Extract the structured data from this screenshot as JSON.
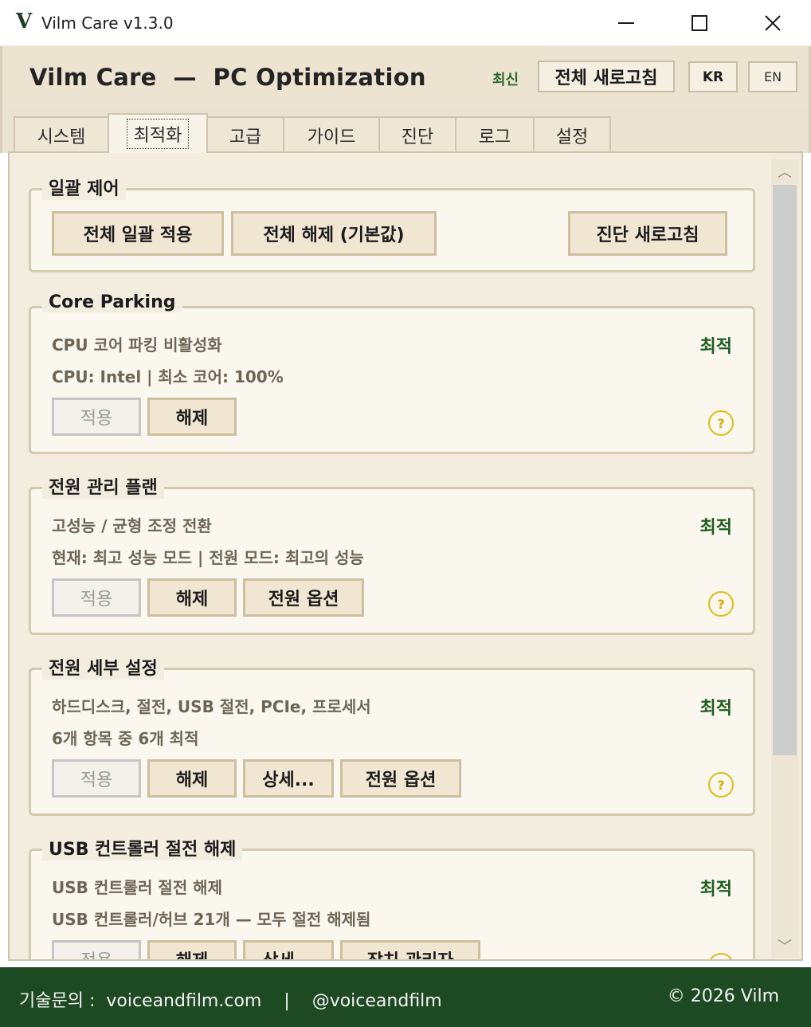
{
  "window": {
    "logo": "V",
    "title": "Vilm Care v1.3.0",
    "minimize": "—",
    "maximize": "☐",
    "close": "✕"
  },
  "header": {
    "app_title": "Vilm Care  —  PC Optimization",
    "latest_badge": "최신",
    "refresh_all": "전체 새로고침",
    "lang_kr": "KR",
    "lang_en": "EN"
  },
  "tabs": [
    {
      "label": "시스템",
      "active": false
    },
    {
      "label": "최적화",
      "active": true
    },
    {
      "label": "고급",
      "active": false
    },
    {
      "label": "가이드",
      "active": false
    },
    {
      "label": "진단",
      "active": false
    },
    {
      "label": "로그",
      "active": false
    },
    {
      "label": "설정",
      "active": false
    }
  ],
  "bulk": {
    "title": "일괄 제어",
    "apply_all": "전체 일괄 적용",
    "release_all": "전체 해제 (기본값)",
    "diag_refresh": "진단 새로고침"
  },
  "sections": [
    {
      "title": "Core Parking",
      "line1": "CPU 코어 파킹 비활성화",
      "line2": "CPU: Intel | 최소 코어: 100%",
      "status": "최적",
      "apply": "적용",
      "release": "해제",
      "help": "?"
    },
    {
      "title": "전원 관리 플랜",
      "line1": "고성능 / 균형 조정 전환",
      "line2": "현재: 최고 성능 모드 | 전원 모드: 최고의 성능",
      "status": "최적",
      "apply": "적용",
      "release": "해제",
      "extra1": "전원 옵션",
      "help": "?"
    },
    {
      "title": "전원 세부 설정",
      "line1": "하드디스크, 절전, USB 절전, PCIe, 프로세서",
      "line2": "6개 항목 중 6개 최적",
      "status": "최적",
      "apply": "적용",
      "release": "해제",
      "extra1": "상세...",
      "extra2": "전원 옵션",
      "help": "?"
    },
    {
      "title": "USB 컨트롤러 절전 해제",
      "line1": "USB 컨트롤러 절전 해제",
      "line2": "USB 컨트롤러/허브 21개 — 모두 절전 해제됨",
      "status": "최적",
      "apply": "적용",
      "release": "해제",
      "extra1": "상세...",
      "extra2": "장치 관리자",
      "help": "?"
    }
  ],
  "scroll": {
    "up": "︿",
    "down": "﹀"
  },
  "footer": {
    "contact": "기술문의 :  voiceandfilm.com    |    @voiceandfilm",
    "copyright": "© 2026 Vilm"
  }
}
